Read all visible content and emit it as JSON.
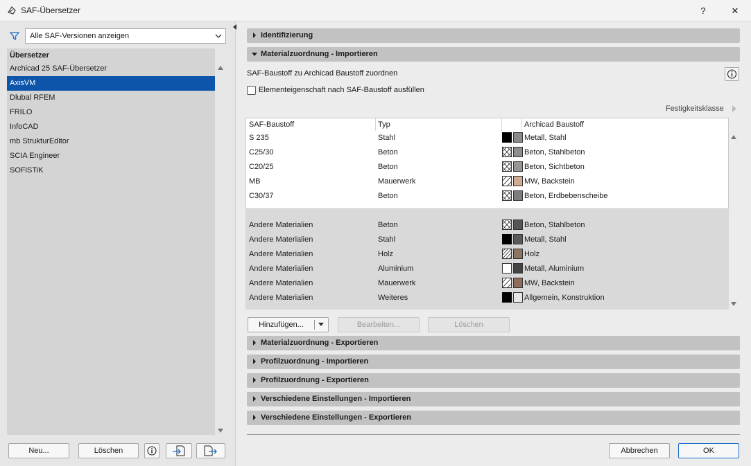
{
  "window": {
    "title": "SAF-Übersetzer",
    "help_label": "?",
    "close_label": "✕"
  },
  "left": {
    "filter_select": "Alle SAF-Versionen anzeigen",
    "list_header": "Übersetzer",
    "items": [
      {
        "label": "Archicad 25 SAF-Übersetzer",
        "selected": false
      },
      {
        "label": "AxisVM",
        "selected": true
      },
      {
        "label": "Dlubal RFEM",
        "selected": false
      },
      {
        "label": "FRILO",
        "selected": false
      },
      {
        "label": "InfoCAD",
        "selected": false
      },
      {
        "label": "mb StrukturEditor",
        "selected": false
      },
      {
        "label": "SCIA Engineer",
        "selected": false
      },
      {
        "label": "SOFiSTiK",
        "selected": false
      }
    ],
    "new_button": "Neu...",
    "delete_button": "Löschen"
  },
  "sections": {
    "identification": "Identifizierung",
    "material_import": "Materialzuordnung - Importieren",
    "material_export": "Materialzuordnung - Exportieren",
    "profile_import": "Profilzuordnung - Importieren",
    "profile_export": "Profilzuordnung - Exportieren",
    "misc_import": "Verschiedene Einstellungen - Importieren",
    "misc_export": "Verschiedene Einstellungen - Exportieren"
  },
  "material_import": {
    "description": "SAF-Baustoff zu Archicad Baustoff zuordnen",
    "checkbox_label": "Elementeigenschaft nach SAF-Baustoff ausfüllen",
    "strength_class_label": "Festigkeitsklasse",
    "columns": {
      "saf": "SAF-Baustoff",
      "type": "Typ",
      "archicad": "Archicad Baustoff"
    },
    "rows": [
      {
        "saf": "S 235",
        "type": "Stahl",
        "archicad": "Metall, Stahl",
        "hatch": "solid",
        "color": "#8a8a8a"
      },
      {
        "saf": "C25/30",
        "type": "Beton",
        "archicad": "Beton, Stahlbeton",
        "hatch": "cross",
        "color": "#8e8e8e"
      },
      {
        "saf": "C20/25",
        "type": "Beton",
        "archicad": "Beton, Sichtbeton",
        "hatch": "cross",
        "color": "#9a9591"
      },
      {
        "saf": "MB",
        "type": "Mauerwerk",
        "archicad": "MW, Backstein",
        "hatch": "diag",
        "color": "#d1aa92"
      },
      {
        "saf": "C30/37",
        "type": "Beton",
        "archicad": "Beton, Erdbebenscheibe",
        "hatch": "cross",
        "color": "#7d7d7d"
      }
    ],
    "other_rows": [
      {
        "saf": "Andere Materialien",
        "type": "Beton",
        "archicad": "Beton, Stahlbeton",
        "hatch": "cross",
        "color": "#555555"
      },
      {
        "saf": "Andere Materialien",
        "type": "Stahl",
        "archicad": "Metall, Stahl",
        "hatch": "solid",
        "color": "#5a5a5a"
      },
      {
        "saf": "Andere Materialien",
        "type": "Holz",
        "archicad": "Holz",
        "hatch": "diag-dense",
        "color": "#8b7560"
      },
      {
        "saf": "Andere Materialien",
        "type": "Aluminium",
        "archicad": "Metall, Aluminium",
        "hatch": "empty",
        "color": "#444444"
      },
      {
        "saf": "Andere Materialien",
        "type": "Mauerwerk",
        "archicad": "MW, Backstein",
        "hatch": "diag",
        "color": "#8d6d5c"
      },
      {
        "saf": "Andere Materialien",
        "type": "Weiteres",
        "archicad": "Allgemein, Konstruktion",
        "hatch": "solid",
        "color": "#e6e6e6"
      }
    ],
    "add_button": "Hinzufügen...",
    "edit_button": "Bearbeiten...",
    "delete_button": "Löschen"
  },
  "footer": {
    "cancel_button": "Abbrechen",
    "ok_button": "OK"
  }
}
